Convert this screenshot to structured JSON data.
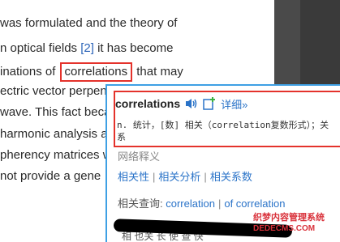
{
  "document": {
    "lines": [
      {
        "before": "was formulated and the theory of",
        "link": "",
        "after": ""
      },
      {
        "before": "n optical fields ",
        "link": "[2]",
        "after": " it has become"
      },
      {
        "before": "inations of ",
        "highlight": "correlations",
        "after": " that may"
      },
      {
        "before": "ectric vector perpendic",
        "link": "",
        "after": ""
      },
      {
        "before": "wave. This fact beca",
        "link": "",
        "after": ""
      },
      {
        "before": " harmonic analysis a",
        "link": "",
        "after": ""
      },
      {
        "before": "pherency matrices wh",
        "link": "",
        "after": ""
      },
      {
        "before": "not provide a gene",
        "link": "",
        "after": ""
      }
    ]
  },
  "popup": {
    "word": "correlations",
    "detail_label": "详细»",
    "definition": "n. 统计，[数] 相关（correlation复数形式）；关系",
    "web_section_title": "网络释义",
    "web_items": [
      "相关性",
      "相关分析",
      "相关系数"
    ],
    "related_label": "相关查询:",
    "related_links": [
      "correlation",
      "of correlation"
    ],
    "footer_text": "相   也关   长 使      查  快"
  },
  "watermark": {
    "line1": "织梦内容管理系统",
    "line2": "DEDECMS.COM"
  },
  "icons": {
    "speaker": "speaker-icon",
    "add": "add-to-wordbook-icon"
  },
  "colors": {
    "highlight_box": "#e4322b",
    "popup_border": "#3ea0e4",
    "link": "#2a73c8"
  }
}
